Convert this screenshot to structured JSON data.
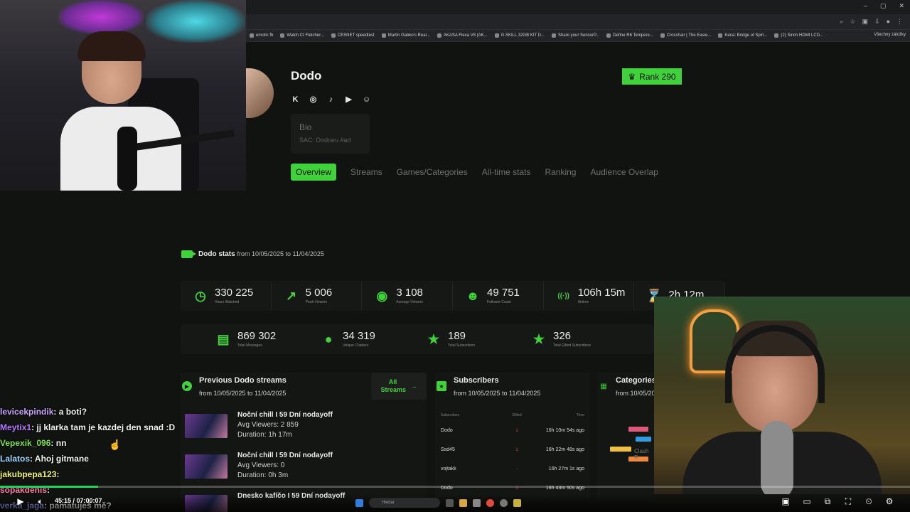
{
  "browser": {
    "bookmarks": [
      "emotic fb",
      "Watch Ct Fletcher...",
      "CESNET speedtest",
      "Martin Gabko's Real...",
      "AKASA Flexa V8 (AK...",
      "G.SKILL 32GB KIT D...",
      "Share your SensorP...",
      "Define R6 Tempere...",
      "Crosshair | The Easie...",
      "Kena: Bridge of Spiri...",
      "(2) Sinch HDMI LCD..."
    ],
    "bookmarks_right": "Všechny záložky"
  },
  "profile": {
    "name": "Dodo",
    "rank": "Rank 290",
    "bio_title": "Bio",
    "bio_text": "SAC: Dodoeu #ad",
    "socials": [
      "kick-icon",
      "instagram-icon",
      "tiktok-icon",
      "youtube-icon",
      "discord-icon"
    ]
  },
  "tabs": [
    "Overview",
    "Streams",
    "Games/Categories",
    "All-time stats",
    "Ranking",
    "Audience Overlap"
  ],
  "stats": {
    "title": "Dodo stats",
    "range": "from 10/05/2025 to 11/04/2025",
    "row1": [
      {
        "value": "330 225",
        "label": "Hours Watched",
        "icon": "clock-icon",
        "glyph": "◷"
      },
      {
        "value": "5 006",
        "label": "Peak Viewers",
        "icon": "trend-up-icon",
        "glyph": "↗"
      },
      {
        "value": "3 108",
        "label": "Average Viewers",
        "icon": "eye-icon",
        "glyph": "◉"
      },
      {
        "value": "49 751",
        "label": "Follower Count",
        "icon": "user-plus-icon",
        "glyph": "☻"
      },
      {
        "value": "106h 15m",
        "label": "Airtime",
        "icon": "broadcast-icon",
        "glyph": "((·))"
      },
      {
        "value": "2h 12m",
        "label": "",
        "icon": "hourglass-icon",
        "glyph": "⌛"
      }
    ],
    "row2": [
      {
        "value": "869 302",
        "label": "Total Messages",
        "icon": "chat-icon",
        "glyph": "▤"
      },
      {
        "value": "34 319",
        "label": "Unique Chatters",
        "icon": "person-icon",
        "glyph": "●"
      },
      {
        "value": "189",
        "label": "Total Subscribers",
        "icon": "star-icon",
        "glyph": "★"
      },
      {
        "value": "326",
        "label": "Total Gifted Subscribers",
        "icon": "star-icon",
        "glyph": "★"
      }
    ]
  },
  "streams_panel": {
    "title": "Previous Dodo streams",
    "range": "from 10/05/2025 to 11/04/2025",
    "all_button": "All Streams",
    "items": [
      {
        "title": "Noční chill I 59 Dní nodayoff",
        "viewers": "Avg Viewers: 2 859",
        "duration": "Duration: 1h 17m"
      },
      {
        "title": "Noční chill I 59 Dní nodayoff",
        "viewers": "Avg Viewers: 0",
        "duration": "Duration: 0h 3m"
      },
      {
        "title": "Dnesko kafíčo I 59 Dní nodayoff",
        "viewers": "",
        "duration": ""
      }
    ]
  },
  "subs_panel": {
    "title": "Subscribers",
    "range": "from 10/05/2025 to 11/04/2025",
    "headers": [
      "Subscribers",
      "Gifted",
      "Time"
    ],
    "rows": [
      {
        "name": "Dodo",
        "gifted": "1",
        "time": "16h 10m 54s ago"
      },
      {
        "name": "Ssd45",
        "gifted": "1",
        "time": "16h 22m 48s ago"
      },
      {
        "name": "vojtakk",
        "gifted": "-",
        "time": "16h 27m 1s ago"
      },
      {
        "name": "Dodo",
        "gifted": "1",
        "time": "16h 43m 50s ago"
      }
    ]
  },
  "cats_panel": {
    "title": "Categories S",
    "range": "from 10/05/20",
    "bar_label": "Clash R",
    "bar_colors": [
      "#e0577a",
      "#2f9be0",
      "#f0c040",
      "#f08a3a"
    ]
  },
  "chat": [
    {
      "user": "levicekpindik",
      "color": "#c9a0ff",
      "msg": ": a boti?"
    },
    {
      "user": "Meytix1",
      "color": "#b479ff",
      "msg": ": jj klarka tam je kazdej den snad :D"
    },
    {
      "user": "Vepexik_096",
      "color": "#7ee04a",
      "msg": ": nn"
    },
    {
      "user": "Lalatos",
      "color": "#9fd8ff",
      "msg": ": Ahoj gitmane"
    },
    {
      "user": "jakubpepa123",
      "color": "#f3f36a",
      "msg": ":"
    },
    {
      "user": "sopakdenis",
      "color": "#ff7aa8",
      "msg": ":"
    },
    {
      "user": "verka_jaga",
      "color": "#a0a0ff",
      "msg": ": pamatuješ mě?"
    }
  ],
  "player": {
    "time": "45:15 / 07:00:07",
    "progress_fraction": 0.108,
    "search_placeholder": "Hledat"
  },
  "colors": {
    "accent": "#3fd23a",
    "progress": "#21d25a"
  }
}
